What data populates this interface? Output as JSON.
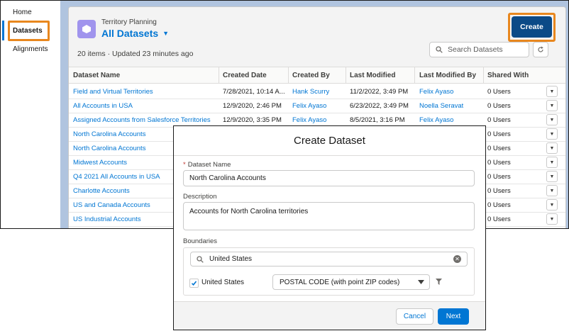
{
  "nav": {
    "items": [
      {
        "label": "Home"
      },
      {
        "label": "Datasets"
      },
      {
        "label": "Alignments"
      }
    ]
  },
  "header": {
    "object_label": "Territory Planning",
    "list_view": "All Datasets",
    "meta": "20 items · Updated 23 minutes ago",
    "create_label": "Create",
    "search_placeholder": "Search Datasets"
  },
  "table": {
    "columns": [
      "Dataset Name",
      "Created Date",
      "Created By",
      "Last Modified",
      "Last Modified By",
      "Shared With"
    ],
    "rows": [
      {
        "name": "Field and Virtual Territories",
        "created": "7/28/2021, 10:14 A...",
        "created_by": "Hank Scurry",
        "modified": "11/2/2022, 3:49 PM",
        "modified_by": "Felix Ayaso",
        "shared": "0 Users"
      },
      {
        "name": "All Accounts in USA",
        "created": "12/9/2020, 2:46 PM",
        "created_by": "Felix Ayaso",
        "modified": "6/23/2022, 3:49 PM",
        "modified_by": "Noella Seravat",
        "shared": "0 Users"
      },
      {
        "name": "Assigned Accounts from Salesforce Territories",
        "created": "12/9/2020, 3:35 PM",
        "created_by": "Felix Ayaso",
        "modified": "8/5/2021, 3:16 PM",
        "modified_by": "Felix Ayaso",
        "shared": "0 Users"
      },
      {
        "name": "North Carolina Accounts",
        "created": "",
        "created_by": "",
        "modified": "",
        "modified_by": "",
        "shared": "0 Users"
      },
      {
        "name": "North Carolina Accounts",
        "created": "",
        "created_by": "",
        "modified": "",
        "modified_by": "",
        "shared": "0 Users"
      },
      {
        "name": "Midwest Accounts",
        "created": "",
        "created_by": "",
        "modified": "",
        "modified_by": "",
        "shared": "0 Users"
      },
      {
        "name": "Q4 2021 All Accounts in USA",
        "created": "",
        "created_by": "",
        "modified": "",
        "modified_by": "",
        "shared": "0 Users"
      },
      {
        "name": "Charlotte Accounts",
        "created": "",
        "created_by": "",
        "modified": "",
        "modified_by": "",
        "shared": "0 Users"
      },
      {
        "name": "US and Canada Accounts",
        "created": "",
        "created_by": "",
        "modified": "",
        "modified_by": "",
        "shared": "0 Users"
      },
      {
        "name": "US Industrial Accounts",
        "created": "",
        "created_by": "",
        "modified": "",
        "modified_by": "",
        "shared": "0 Users"
      }
    ]
  },
  "modal": {
    "title": "Create Dataset",
    "required_mark": "*",
    "name_label": "Dataset Name",
    "name_value": "North Carolina Accounts",
    "description_label": "Description",
    "description_value": "Accounts for North Carolina territories",
    "boundaries_label": "Boundaries",
    "boundary_search_value": "United States",
    "boundary_item_label": "United States",
    "boundary_item_checked": true,
    "boundary_type_value": "POSTAL CODE (with point ZIP codes)",
    "cancel_label": "Cancel",
    "next_label": "Next"
  },
  "colors": {
    "brand": "#0176d3",
    "create_button": "#0b4a87",
    "highlight": "#e8871e",
    "object_icon": "#a094ed"
  }
}
